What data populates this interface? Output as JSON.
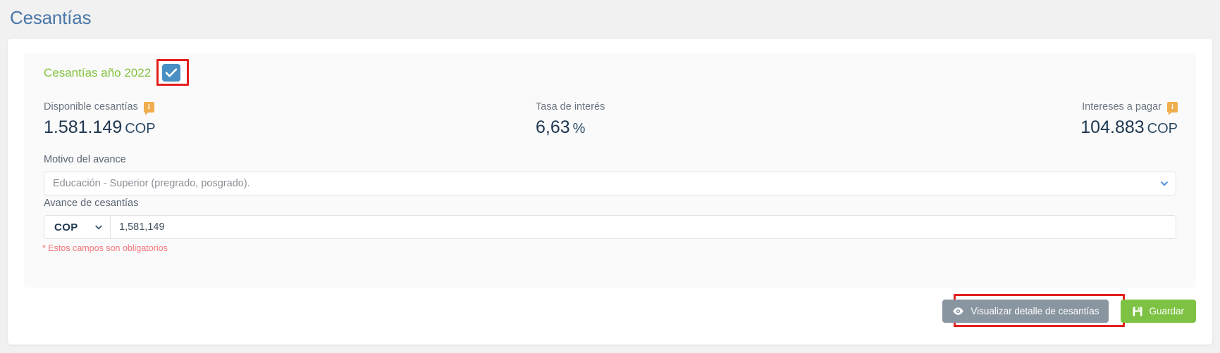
{
  "page": {
    "title": "Cesantías"
  },
  "panel": {
    "year_label": "Cesantías año 2022",
    "checkbox_checked": true,
    "stats": [
      {
        "label": "Disponible cesantías",
        "has_info_icon": true,
        "value": "1.581.149",
        "unit": "COP",
        "align": "left"
      },
      {
        "label": "Tasa de interés",
        "has_info_icon": false,
        "value": "6,63",
        "unit": "%",
        "align": "center"
      },
      {
        "label": "Intereses a pagar",
        "has_info_icon": true,
        "value": "104.883",
        "unit": "COP",
        "align": "right"
      }
    ],
    "motivo": {
      "label": "Motivo del avance",
      "selected": "Educación - Superior (pregrado, posgrado)."
    },
    "avance": {
      "label": "Avance de cesantías",
      "currency": "COP",
      "amount": "1,581,149"
    },
    "required_note": "* Estos campos son obligatorios"
  },
  "footer": {
    "detail_button": "Visualizar detalle de cesantías",
    "save_button": "Guardar"
  },
  "icons": {
    "info": "i",
    "checkbox_check": "check-icon",
    "chevron": "chevron-down-icon",
    "eye": "eye-icon",
    "save": "floppy-disk-icon"
  },
  "colors": {
    "title_blue": "#4a77a8",
    "year_green": "#84c341",
    "checkbox_blue": "#4a8fc4",
    "info_orange": "#f0ad4e",
    "value_navy": "#1f3650",
    "required_red": "#f4767d",
    "annotation_red": "#e31f1f",
    "secondary_grey": "#8995a0",
    "primary_green": "#7dc242"
  }
}
